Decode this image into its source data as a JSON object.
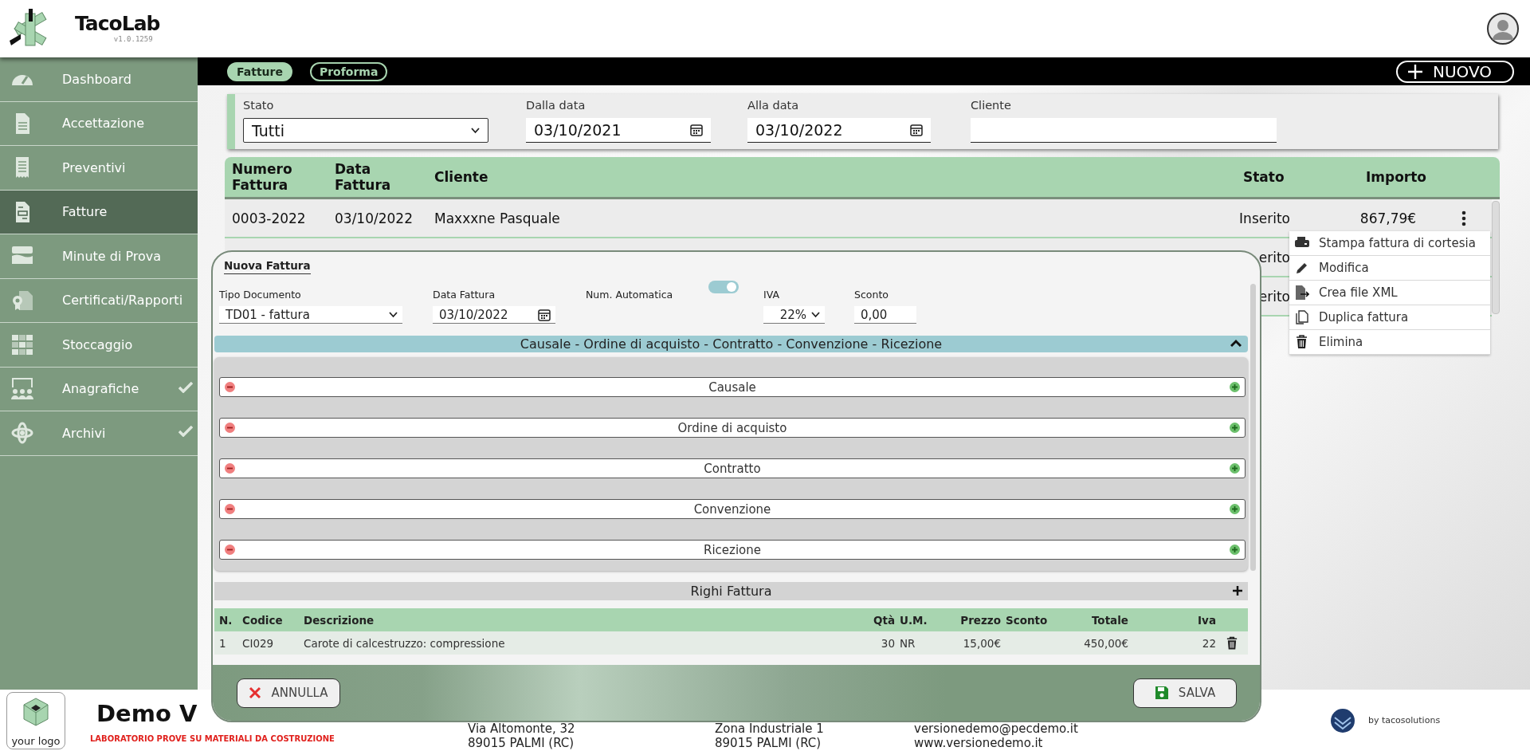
{
  "app": {
    "name": "TacoLab",
    "version": "v1.0.1259"
  },
  "sidebar": {
    "items": [
      {
        "label": "Dashboard",
        "selected": false,
        "has_submenu": false
      },
      {
        "label": "Accettazione",
        "selected": false,
        "has_submenu": false
      },
      {
        "label": "Preventivi",
        "selected": false,
        "has_submenu": false
      },
      {
        "label": "Fatture",
        "selected": true,
        "has_submenu": false
      },
      {
        "label": "Minute di Prova",
        "selected": false,
        "has_submenu": false
      },
      {
        "label": "Certificati/Rapporti",
        "selected": false,
        "has_submenu": false
      },
      {
        "label": "Stoccaggio",
        "selected": false,
        "has_submenu": false
      },
      {
        "label": "Anagrafiche",
        "selected": false,
        "has_submenu": true
      },
      {
        "label": "Archivi",
        "selected": false,
        "has_submenu": true
      }
    ]
  },
  "tabs": [
    {
      "label": "Fatture",
      "selected": true
    },
    {
      "label": "Proforma",
      "selected": false
    }
  ],
  "new_button": {
    "label": "NUOVO"
  },
  "filters": [
    {
      "label": "Stato",
      "kind": "select",
      "value": "Tutti"
    },
    {
      "label": "Dalla data",
      "kind": "date",
      "value": "03/10/2021"
    },
    {
      "label": "Alla data",
      "kind": "date",
      "value": "03/10/2022"
    },
    {
      "label": "Cliente",
      "kind": "text"
    }
  ],
  "table": {
    "columns": [
      "Numero Fattura",
      "Data Fattura",
      "Cliente",
      "Stato",
      "Importo"
    ],
    "rows": [
      {
        "numero": "0003-2022",
        "data": "03/10/2022",
        "cliente": "Maxxxne Pasquale",
        "stato": "Inserito",
        "importo": "867,79€"
      },
      {
        "stato": "erito"
      },
      {
        "stato": "erito"
      }
    ]
  },
  "row_menu": {
    "items": [
      "Stampa fattura di cortesia",
      "Modifica",
      "Crea file XML",
      "Duplica fattura",
      "Elimina"
    ]
  },
  "modal": {
    "title": "Nuova Fattura",
    "fields": [
      {
        "label": "Tipo Documento",
        "kind": "select",
        "value": "TD01 - fattura"
      },
      {
        "label": "Data Fattura",
        "kind": "date",
        "value": "03/10/2022"
      },
      {
        "label": "Num. Automatica",
        "kind": "toggle",
        "on": true
      },
      {
        "label": "IVA",
        "kind": "select",
        "value": "22%"
      },
      {
        "label": "Sconto",
        "kind": "number",
        "value": "0,00"
      }
    ],
    "section": {
      "title": "Causale - Ordine di acquisto - Contratto - Convenzione - Ricezione",
      "expanded": true,
      "items": [
        "Causale",
        "Ordine di acquisto",
        "Contratto",
        "Convenzione",
        "Ricezione"
      ]
    },
    "lines": {
      "title": "Righi Fattura",
      "columns": [
        "N.",
        "Codice",
        "Descrizione",
        "Qtà",
        "U.M.",
        "Prezzo",
        "Sconto",
        "Totale",
        "Iva"
      ],
      "rows": [
        [
          "1",
          "CI029",
          "Carote di calcestruzzo: compressione",
          "30",
          "NR",
          "15,00€",
          "",
          "450,00€",
          "22"
        ]
      ]
    },
    "buttons": [
      {
        "label": "ANNULLA",
        "kind": "cancel"
      },
      {
        "label": "SALVA",
        "kind": "save"
      }
    ]
  },
  "footer": {
    "logo_label": "your logo",
    "company": "Demo V",
    "tagline": "LABORATORIO PROVE SU MATERIALI DA COSTRUZIONE",
    "contacts": [
      [
        "Via Altomonte, 32",
        "89015 PALMI (RC)"
      ],
      [
        "Zona Industriale 1",
        "89015 PALMI (RC)"
      ],
      [
        "versionedemo@pecdemo.it",
        "www.versionedemo.it"
      ]
    ],
    "credit": "by tacosolutions"
  }
}
